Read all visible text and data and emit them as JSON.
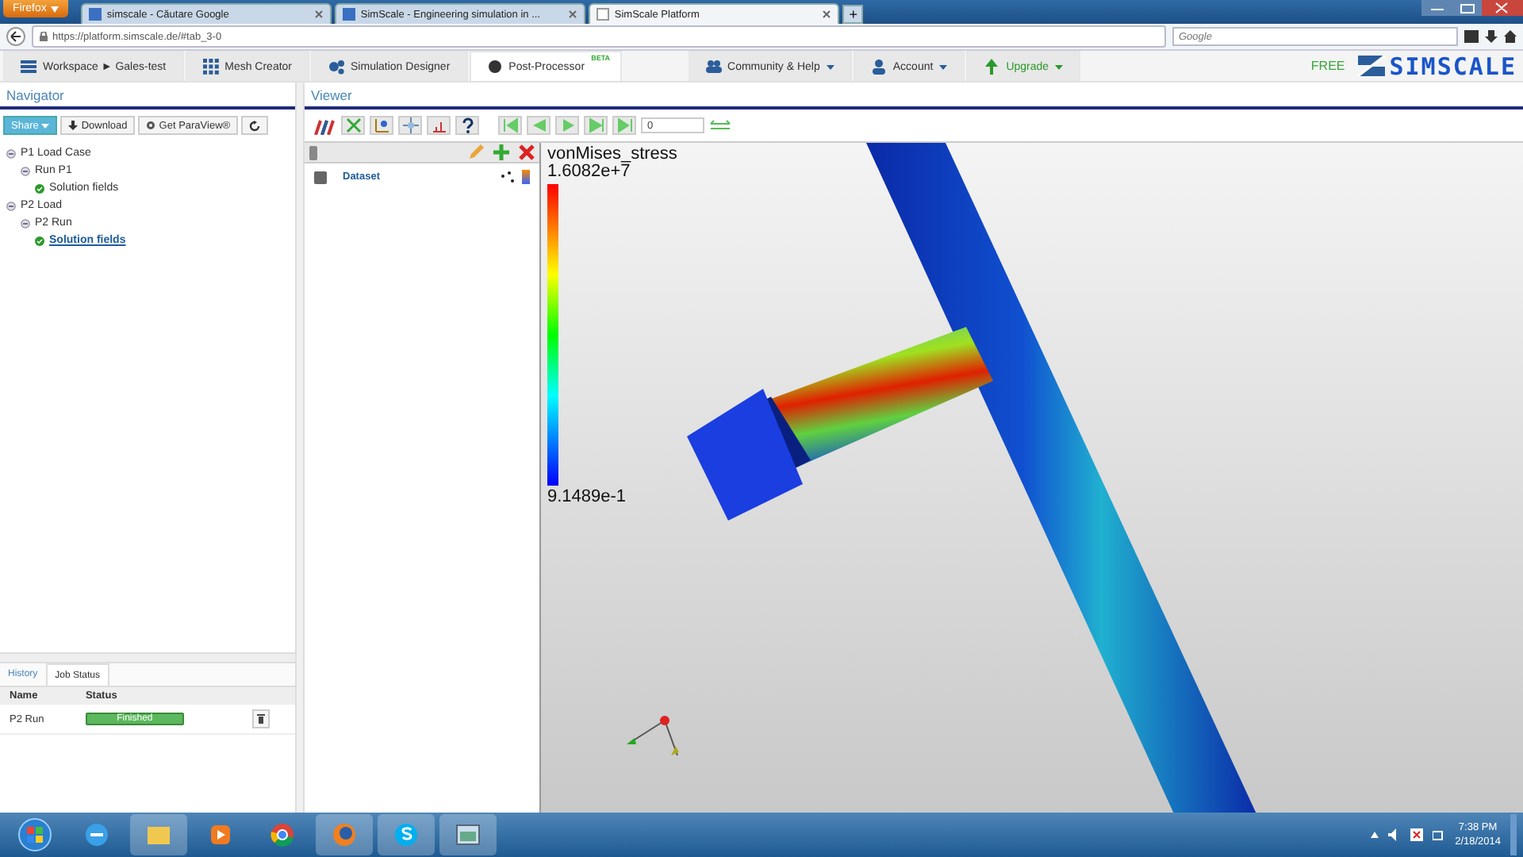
{
  "browser": {
    "menu_button": "Firefox",
    "tabs": [
      {
        "title": "simscale - Căutare Google",
        "selected": false
      },
      {
        "title": "SimScale - Engineering simulation in ...",
        "selected": false
      },
      {
        "title": "SimScale Platform",
        "selected": true
      }
    ],
    "new_tab": "+",
    "url": "https://platform.simscale.de/#tab_3-0",
    "search_placeholder": "Google"
  },
  "app_nav": {
    "items": [
      {
        "label": "Workspace ► Gales-test",
        "selected": false,
        "kind": "tab"
      },
      {
        "label": "Mesh Creator",
        "selected": false,
        "kind": "tab"
      },
      {
        "label": "Simulation Designer",
        "selected": false,
        "kind": "tab"
      },
      {
        "label": "Post-Processor",
        "badge": "BETA",
        "selected": true,
        "kind": "tab"
      },
      {
        "label": "Community & Help",
        "selected": false,
        "kind": "menu"
      },
      {
        "label": "Account",
        "selected": false,
        "kind": "menu"
      },
      {
        "label": "Upgrade",
        "selected": false,
        "kind": "menu"
      }
    ],
    "plan": "FREE",
    "logo": "SIMSCALE"
  },
  "navigator": {
    "title": "Navigator",
    "buttons": [
      "Share",
      "Download",
      "Get ParaView®"
    ],
    "tree": [
      {
        "label": "P1 Load Case",
        "expanded": true,
        "selected": false,
        "children": [
          {
            "label": "Run P1",
            "expanded": true,
            "selected": false,
            "children": [
              {
                "label": "Solution fields",
                "selected": false
              }
            ]
          }
        ]
      },
      {
        "label": "P2 Load",
        "expanded": true,
        "selected": false,
        "children": [
          {
            "label": "P2 Run",
            "expanded": true,
            "selected": false,
            "children": [
              {
                "label": "Solution fields",
                "selected": true
              }
            ]
          }
        ]
      }
    ]
  },
  "bottom_panel": {
    "tabs": [
      {
        "label": "History",
        "selected": false
      },
      {
        "label": "Job Status",
        "selected": true
      }
    ],
    "columns": [
      "Name",
      "Status"
    ],
    "rows": [
      {
        "name": "P2 Run",
        "status": "Finished"
      }
    ]
  },
  "viewer": {
    "title": "Viewer",
    "frame": "0",
    "pipeline": [
      {
        "label": "Dataset"
      }
    ],
    "legend": {
      "title": "vonMises_stress",
      "max": "1.6082e+7",
      "min": "9.1489e-1"
    }
  },
  "taskbar": {
    "time": "7:38 PM",
    "date": "2/18/2014"
  }
}
